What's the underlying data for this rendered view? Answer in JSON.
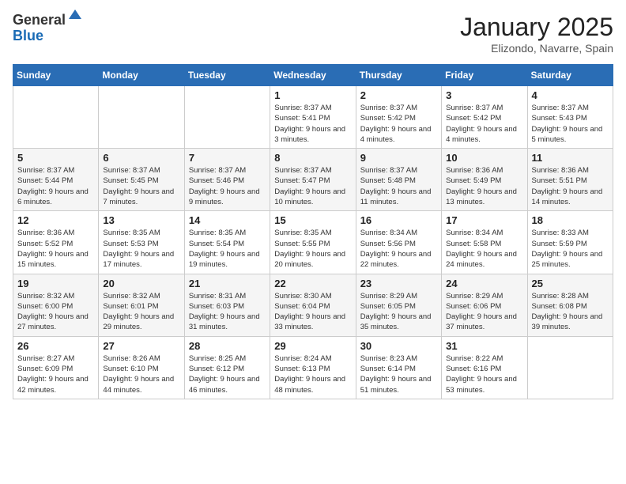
{
  "logo": {
    "general": "General",
    "blue": "Blue"
  },
  "title": "January 2025",
  "location": "Elizondo, Navarre, Spain",
  "days_of_week": [
    "Sunday",
    "Monday",
    "Tuesday",
    "Wednesday",
    "Thursday",
    "Friday",
    "Saturday"
  ],
  "weeks": [
    [
      {
        "day": "",
        "info": ""
      },
      {
        "day": "",
        "info": ""
      },
      {
        "day": "",
        "info": ""
      },
      {
        "day": "1",
        "info": "Sunrise: 8:37 AM\nSunset: 5:41 PM\nDaylight: 9 hours and 3 minutes."
      },
      {
        "day": "2",
        "info": "Sunrise: 8:37 AM\nSunset: 5:42 PM\nDaylight: 9 hours and 4 minutes."
      },
      {
        "day": "3",
        "info": "Sunrise: 8:37 AM\nSunset: 5:42 PM\nDaylight: 9 hours and 4 minutes."
      },
      {
        "day": "4",
        "info": "Sunrise: 8:37 AM\nSunset: 5:43 PM\nDaylight: 9 hours and 5 minutes."
      }
    ],
    [
      {
        "day": "5",
        "info": "Sunrise: 8:37 AM\nSunset: 5:44 PM\nDaylight: 9 hours and 6 minutes."
      },
      {
        "day": "6",
        "info": "Sunrise: 8:37 AM\nSunset: 5:45 PM\nDaylight: 9 hours and 7 minutes."
      },
      {
        "day": "7",
        "info": "Sunrise: 8:37 AM\nSunset: 5:46 PM\nDaylight: 9 hours and 9 minutes."
      },
      {
        "day": "8",
        "info": "Sunrise: 8:37 AM\nSunset: 5:47 PM\nDaylight: 9 hours and 10 minutes."
      },
      {
        "day": "9",
        "info": "Sunrise: 8:37 AM\nSunset: 5:48 PM\nDaylight: 9 hours and 11 minutes."
      },
      {
        "day": "10",
        "info": "Sunrise: 8:36 AM\nSunset: 5:49 PM\nDaylight: 9 hours and 13 minutes."
      },
      {
        "day": "11",
        "info": "Sunrise: 8:36 AM\nSunset: 5:51 PM\nDaylight: 9 hours and 14 minutes."
      }
    ],
    [
      {
        "day": "12",
        "info": "Sunrise: 8:36 AM\nSunset: 5:52 PM\nDaylight: 9 hours and 15 minutes."
      },
      {
        "day": "13",
        "info": "Sunrise: 8:35 AM\nSunset: 5:53 PM\nDaylight: 9 hours and 17 minutes."
      },
      {
        "day": "14",
        "info": "Sunrise: 8:35 AM\nSunset: 5:54 PM\nDaylight: 9 hours and 19 minutes."
      },
      {
        "day": "15",
        "info": "Sunrise: 8:35 AM\nSunset: 5:55 PM\nDaylight: 9 hours and 20 minutes."
      },
      {
        "day": "16",
        "info": "Sunrise: 8:34 AM\nSunset: 5:56 PM\nDaylight: 9 hours and 22 minutes."
      },
      {
        "day": "17",
        "info": "Sunrise: 8:34 AM\nSunset: 5:58 PM\nDaylight: 9 hours and 24 minutes."
      },
      {
        "day": "18",
        "info": "Sunrise: 8:33 AM\nSunset: 5:59 PM\nDaylight: 9 hours and 25 minutes."
      }
    ],
    [
      {
        "day": "19",
        "info": "Sunrise: 8:32 AM\nSunset: 6:00 PM\nDaylight: 9 hours and 27 minutes."
      },
      {
        "day": "20",
        "info": "Sunrise: 8:32 AM\nSunset: 6:01 PM\nDaylight: 9 hours and 29 minutes."
      },
      {
        "day": "21",
        "info": "Sunrise: 8:31 AM\nSunset: 6:03 PM\nDaylight: 9 hours and 31 minutes."
      },
      {
        "day": "22",
        "info": "Sunrise: 8:30 AM\nSunset: 6:04 PM\nDaylight: 9 hours and 33 minutes."
      },
      {
        "day": "23",
        "info": "Sunrise: 8:29 AM\nSunset: 6:05 PM\nDaylight: 9 hours and 35 minutes."
      },
      {
        "day": "24",
        "info": "Sunrise: 8:29 AM\nSunset: 6:06 PM\nDaylight: 9 hours and 37 minutes."
      },
      {
        "day": "25",
        "info": "Sunrise: 8:28 AM\nSunset: 6:08 PM\nDaylight: 9 hours and 39 minutes."
      }
    ],
    [
      {
        "day": "26",
        "info": "Sunrise: 8:27 AM\nSunset: 6:09 PM\nDaylight: 9 hours and 42 minutes."
      },
      {
        "day": "27",
        "info": "Sunrise: 8:26 AM\nSunset: 6:10 PM\nDaylight: 9 hours and 44 minutes."
      },
      {
        "day": "28",
        "info": "Sunrise: 8:25 AM\nSunset: 6:12 PM\nDaylight: 9 hours and 46 minutes."
      },
      {
        "day": "29",
        "info": "Sunrise: 8:24 AM\nSunset: 6:13 PM\nDaylight: 9 hours and 48 minutes."
      },
      {
        "day": "30",
        "info": "Sunrise: 8:23 AM\nSunset: 6:14 PM\nDaylight: 9 hours and 51 minutes."
      },
      {
        "day": "31",
        "info": "Sunrise: 8:22 AM\nSunset: 6:16 PM\nDaylight: 9 hours and 53 minutes."
      },
      {
        "day": "",
        "info": ""
      }
    ]
  ]
}
